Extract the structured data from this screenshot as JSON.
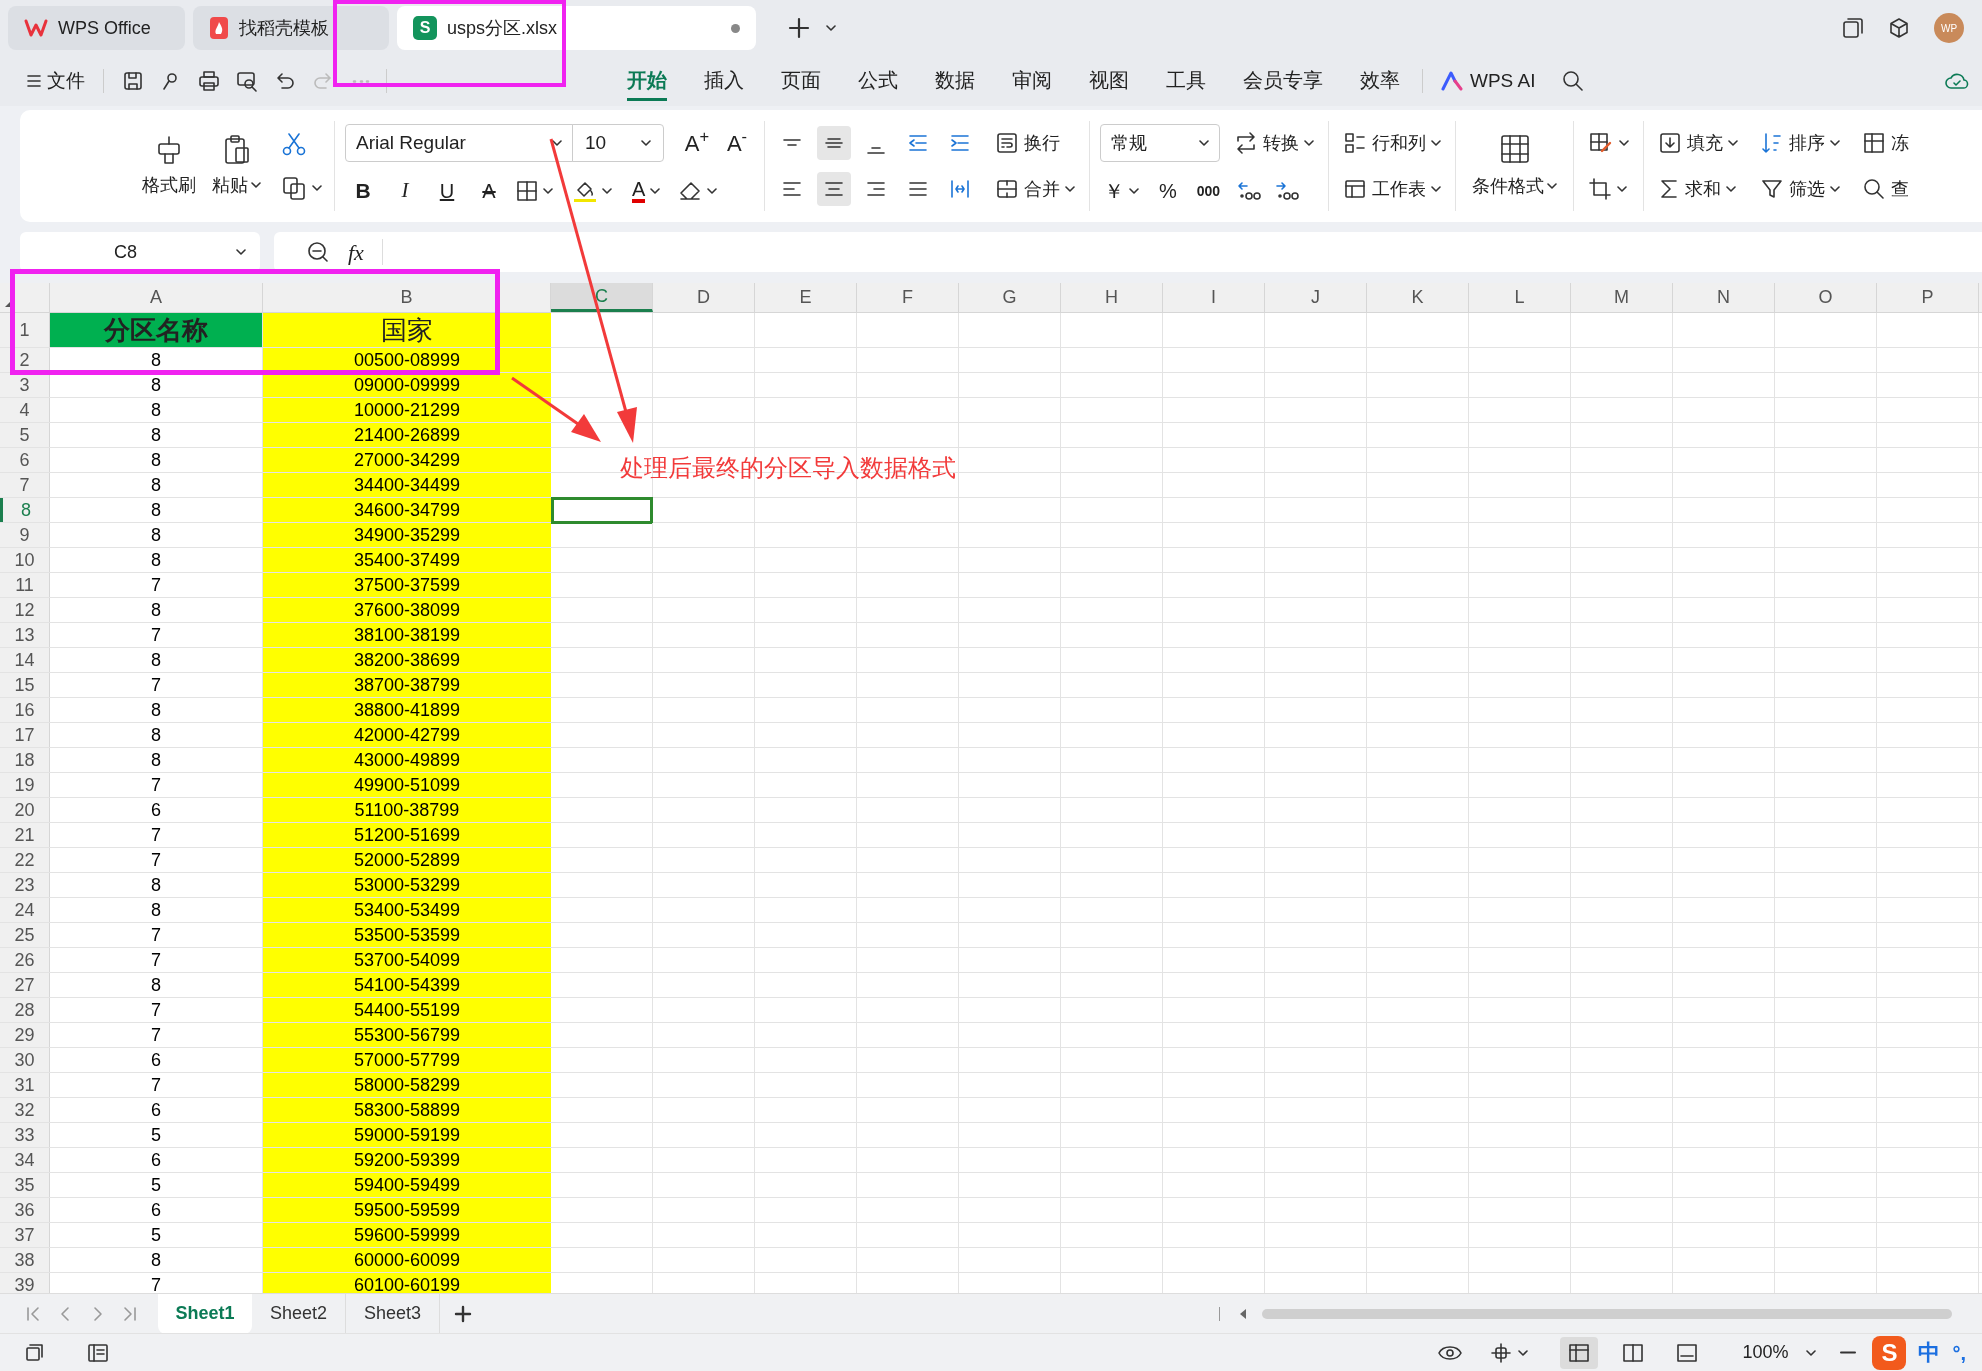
{
  "title_tabs": [
    {
      "kind": "home",
      "label": "WPS Office",
      "selected": false,
      "unsaved": false
    },
    {
      "kind": "docer",
      "label": "找稻壳模板",
      "selected": false,
      "unsaved": false
    },
    {
      "kind": "sheet",
      "logo": "S",
      "label": "usps分区.xlsx",
      "selected": true,
      "unsaved": true
    }
  ],
  "avatar": "WP",
  "menu": {
    "file": "文件",
    "tabs": [
      {
        "label": "开始",
        "selected": true
      },
      {
        "label": "插入",
        "selected": false
      },
      {
        "label": "页面",
        "selected": false
      },
      {
        "label": "公式",
        "selected": false
      },
      {
        "label": "数据",
        "selected": false
      },
      {
        "label": "审阅",
        "selected": false
      },
      {
        "label": "视图",
        "selected": false
      },
      {
        "label": "工具",
        "selected": false
      },
      {
        "label": "会员专享",
        "selected": false
      },
      {
        "label": "效率",
        "selected": false
      }
    ],
    "ai": "WPS AI"
  },
  "ribbon": {
    "format_painter": "格式刷",
    "paste": "粘贴",
    "font_name": "Arial Regular",
    "font_size": "10",
    "grow_font": "A$^{+}$",
    "shrink_font": "A$^{-}$",
    "bold": "B",
    "italic": "I",
    "underline": "U",
    "strike": "A",
    "font_color": "A",
    "wrap": "换行",
    "merge": "合并",
    "number_format": "常规",
    "convert": "转换",
    "currency": "￥",
    "percent": "%",
    "thousands": "000",
    "rows_cols": "行和列",
    "worksheet": "工作表",
    "conditional": "条件格式",
    "fill": "填充",
    "sum": "求和",
    "sort": "排序",
    "filter": "筛选",
    "freeze": "冻",
    "find": "查"
  },
  "name_box": "C8",
  "formula_label": "fx",
  "columns": [
    {
      "label": "A",
      "selected": false
    },
    {
      "label": "B",
      "selected": false
    },
    {
      "label": "C",
      "selected": true
    },
    {
      "label": "D",
      "selected": false
    },
    {
      "label": "E",
      "selected": false
    },
    {
      "label": "F",
      "selected": false
    },
    {
      "label": "G",
      "selected": false
    },
    {
      "label": "H",
      "selected": false
    },
    {
      "label": "I",
      "selected": false
    },
    {
      "label": "J",
      "selected": false
    },
    {
      "label": "K",
      "selected": false
    },
    {
      "label": "L",
      "selected": false
    },
    {
      "label": "M",
      "selected": false
    },
    {
      "label": "N",
      "selected": false
    },
    {
      "label": "O",
      "selected": false
    },
    {
      "label": "P",
      "selected": false
    }
  ],
  "header_row": {
    "n": "1",
    "zone": "分区名称",
    "range": "国家"
  },
  "rows": [
    {
      "n": "2",
      "zone": "8",
      "range": "00500-08999",
      "selected": false
    },
    {
      "n": "3",
      "zone": "8",
      "range": "09000-09999",
      "selected": false
    },
    {
      "n": "4",
      "zone": "8",
      "range": "10000-21299",
      "selected": false
    },
    {
      "n": "5",
      "zone": "8",
      "range": "21400-26899",
      "selected": false
    },
    {
      "n": "6",
      "zone": "8",
      "range": "27000-34299",
      "selected": false
    },
    {
      "n": "7",
      "zone": "8",
      "range": "34400-34499",
      "selected": false
    },
    {
      "n": "8",
      "zone": "8",
      "range": "34600-34799",
      "selected": true
    },
    {
      "n": "9",
      "zone": "8",
      "range": "34900-35299",
      "selected": false
    },
    {
      "n": "10",
      "zone": "8",
      "range": "35400-37499",
      "selected": false
    },
    {
      "n": "11",
      "zone": "7",
      "range": "37500-37599",
      "selected": false
    },
    {
      "n": "12",
      "zone": "8",
      "range": "37600-38099",
      "selected": false
    },
    {
      "n": "13",
      "zone": "7",
      "range": "38100-38199",
      "selected": false
    },
    {
      "n": "14",
      "zone": "8",
      "range": "38200-38699",
      "selected": false
    },
    {
      "n": "15",
      "zone": "7",
      "range": "38700-38799",
      "selected": false
    },
    {
      "n": "16",
      "zone": "8",
      "range": "38800-41899",
      "selected": false
    },
    {
      "n": "17",
      "zone": "8",
      "range": "42000-42799",
      "selected": false
    },
    {
      "n": "18",
      "zone": "8",
      "range": "43000-49899",
      "selected": false
    },
    {
      "n": "19",
      "zone": "7",
      "range": "49900-51099",
      "selected": false
    },
    {
      "n": "20",
      "zone": "6",
      "range": "51100-38799",
      "selected": false
    },
    {
      "n": "21",
      "zone": "7",
      "range": "51200-51699",
      "selected": false
    },
    {
      "n": "22",
      "zone": "7",
      "range": "52000-52899",
      "selected": false
    },
    {
      "n": "23",
      "zone": "8",
      "range": "53000-53299",
      "selected": false
    },
    {
      "n": "24",
      "zone": "8",
      "range": "53400-53499",
      "selected": false
    },
    {
      "n": "25",
      "zone": "7",
      "range": "53500-53599",
      "selected": false
    },
    {
      "n": "26",
      "zone": "7",
      "range": "53700-54099",
      "selected": false
    },
    {
      "n": "27",
      "zone": "8",
      "range": "54100-54399",
      "selected": false
    },
    {
      "n": "28",
      "zone": "7",
      "range": "54400-55199",
      "selected": false
    },
    {
      "n": "29",
      "zone": "7",
      "range": "55300-56799",
      "selected": false
    },
    {
      "n": "30",
      "zone": "6",
      "range": "57000-57799",
      "selected": false
    },
    {
      "n": "31",
      "zone": "7",
      "range": "58000-58299",
      "selected": false
    },
    {
      "n": "32",
      "zone": "6",
      "range": "58300-58899",
      "selected": false
    },
    {
      "n": "33",
      "zone": "5",
      "range": "59000-59199",
      "selected": false
    },
    {
      "n": "34",
      "zone": "6",
      "range": "59200-59399",
      "selected": false
    },
    {
      "n": "35",
      "zone": "5",
      "range": "59400-59499",
      "selected": false
    },
    {
      "n": "36",
      "zone": "6",
      "range": "59500-59599",
      "selected": false
    },
    {
      "n": "37",
      "zone": "5",
      "range": "59600-59999",
      "selected": false
    },
    {
      "n": "38",
      "zone": "8",
      "range": "60000-60099",
      "selected": false
    },
    {
      "n": "39",
      "zone": "7",
      "range": "60100-60199",
      "selected": false
    }
  ],
  "annotation": {
    "note": "处理后最终的分区导入数据格式"
  },
  "sheet_tabs": [
    {
      "label": "Sheet1",
      "selected": true
    },
    {
      "label": "Sheet2",
      "selected": false
    },
    {
      "label": "Sheet3",
      "selected": false
    }
  ],
  "status": {
    "zoom": "100%"
  },
  "ime": {
    "logo": "S",
    "mode": "中",
    "punct": "°,"
  }
}
